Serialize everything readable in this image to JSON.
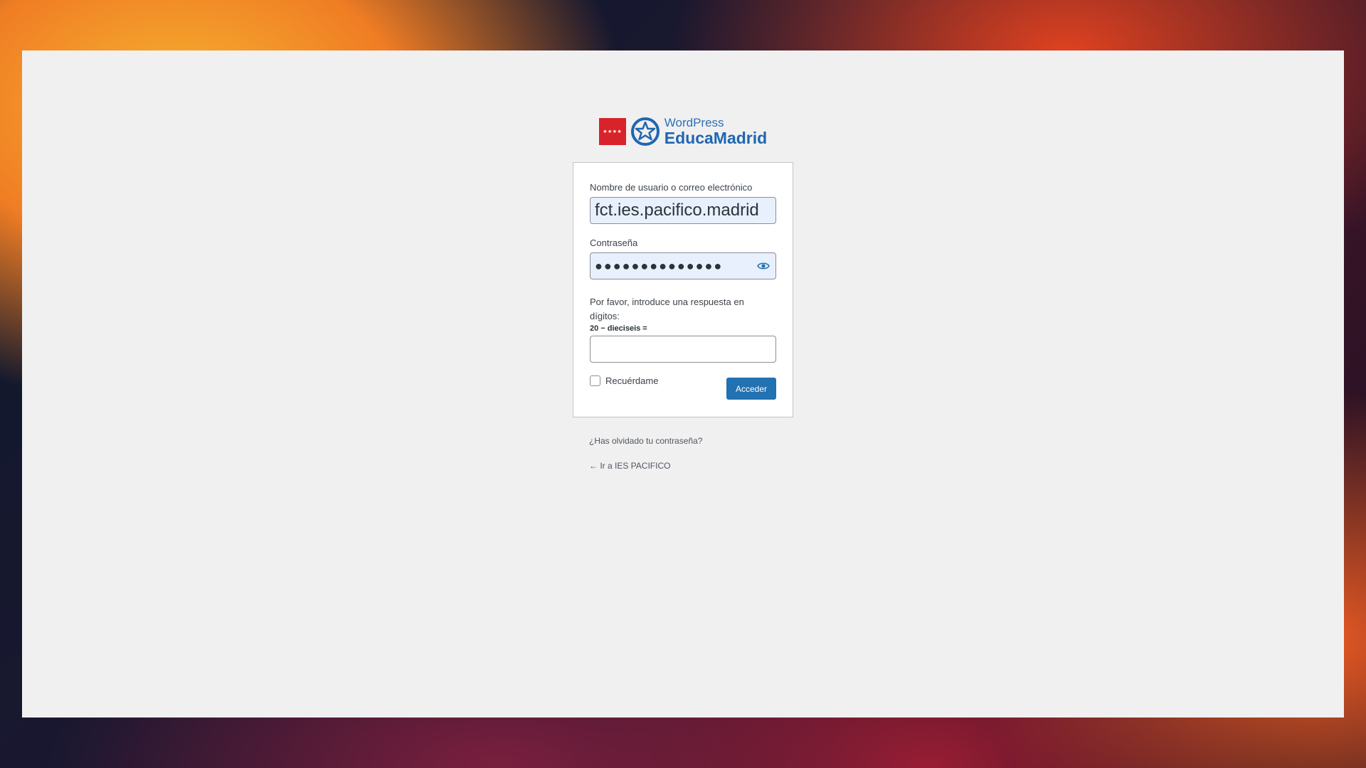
{
  "logo": {
    "flag_stars": "★★★★",
    "line1": "WordPress",
    "line2": "EducaMadrid"
  },
  "form": {
    "username_label": "Nombre de usuario o correo electrónico",
    "username_value": "fct.ies.pacifico.madrid",
    "password_label": "Contraseña",
    "password_value": "●●●●●●●●●●●●●●",
    "captcha_question": "Por favor, introduce una respuesta en dígitos:",
    "captcha_equation": "20 − dieciseis =",
    "captcha_value": "",
    "remember_label": "Recuérdame",
    "remember_checked": false,
    "submit_label": "Acceder"
  },
  "links": {
    "lost_password": "¿Has olvidado tu contraseña?",
    "back_to_site": "← Ir a IES PACIFICO"
  },
  "colors": {
    "primary": "#2271b1",
    "brand_red": "#d8232a",
    "brand_blue": "#1f66b1"
  }
}
